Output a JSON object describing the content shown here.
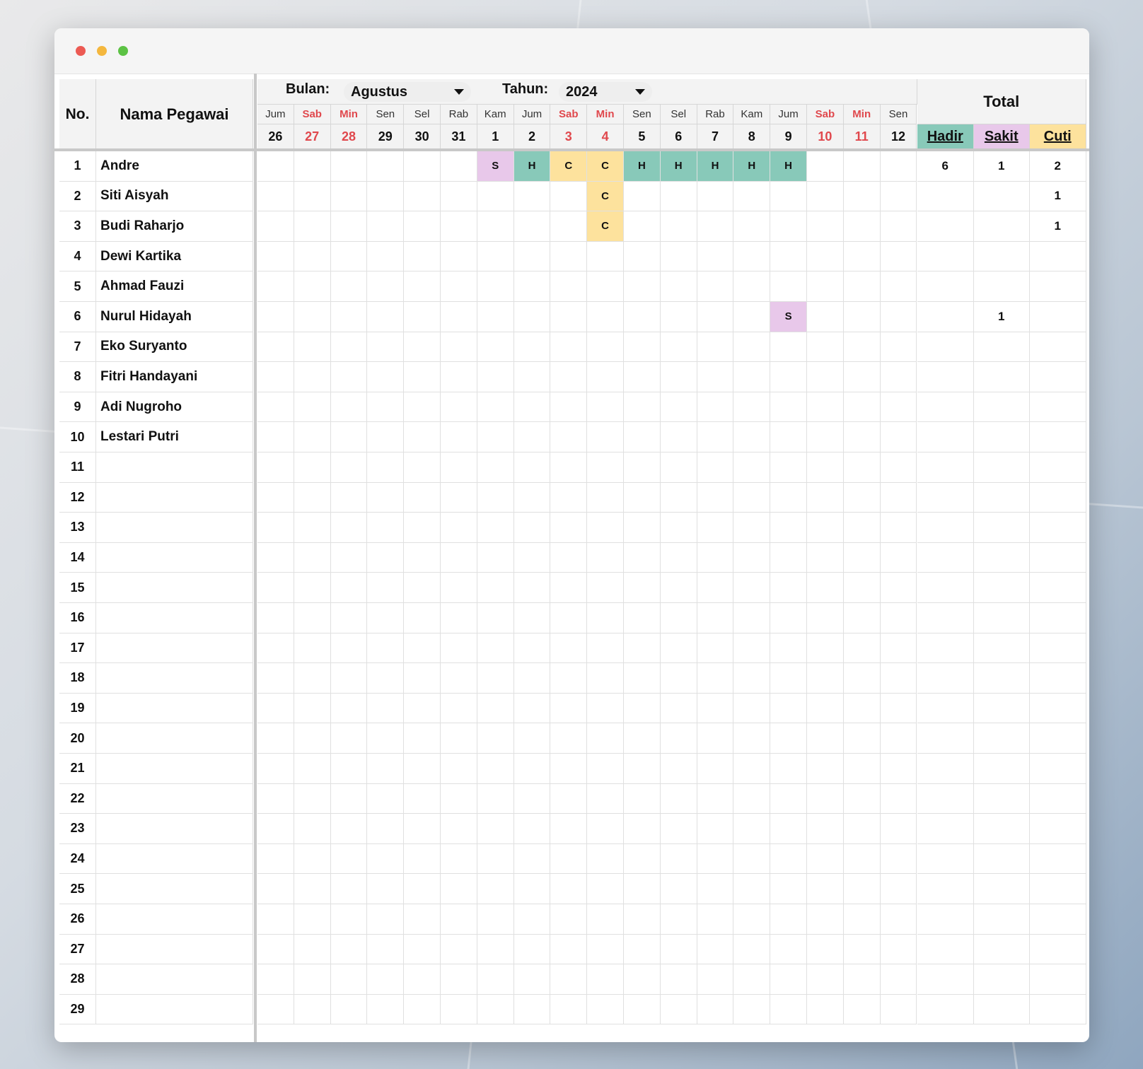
{
  "window": {
    "controls": [
      "close",
      "minimize",
      "maximize"
    ]
  },
  "header": {
    "no_label": "No.",
    "name_label": "Nama Pegawai",
    "month_label": "Bulan:",
    "month_value": "Agustus",
    "year_label": "Tahun:",
    "year_value": "2024",
    "total_label": "Total",
    "hadir_label": "Hadir",
    "sakit_label": "Sakit",
    "cuti_label": "Cuti"
  },
  "days": [
    {
      "weekday": "Jum",
      "date": "26",
      "weekend": false
    },
    {
      "weekday": "Sab",
      "date": "27",
      "weekend": true
    },
    {
      "weekday": "Min",
      "date": "28",
      "weekend": true
    },
    {
      "weekday": "Sen",
      "date": "29",
      "weekend": false
    },
    {
      "weekday": "Sel",
      "date": "30",
      "weekend": false
    },
    {
      "weekday": "Rab",
      "date": "31",
      "weekend": false
    },
    {
      "weekday": "Kam",
      "date": "1",
      "weekend": false
    },
    {
      "weekday": "Jum",
      "date": "2",
      "weekend": false
    },
    {
      "weekday": "Sab",
      "date": "3",
      "weekend": true
    },
    {
      "weekday": "Min",
      "date": "4",
      "weekend": true
    },
    {
      "weekday": "Sen",
      "date": "5",
      "weekend": false
    },
    {
      "weekday": "Sel",
      "date": "6",
      "weekend": false
    },
    {
      "weekday": "Rab",
      "date": "7",
      "weekend": false
    },
    {
      "weekday": "Kam",
      "date": "8",
      "weekend": false
    },
    {
      "weekday": "Jum",
      "date": "9",
      "weekend": false
    },
    {
      "weekday": "Sab",
      "date": "10",
      "weekend": true
    },
    {
      "weekday": "Min",
      "date": "11",
      "weekend": true
    },
    {
      "weekday": "Sen",
      "date": "12",
      "weekend": false
    }
  ],
  "rows": [
    {
      "no": "1",
      "name": "Andre",
      "marks": [
        "",
        "",
        "",
        "",
        "",
        "",
        "S",
        "H",
        "C",
        "C",
        "H",
        "H",
        "H",
        "H",
        "H",
        "",
        "",
        ""
      ],
      "hadir": "6",
      "sakit": "1",
      "cuti": "2"
    },
    {
      "no": "2",
      "name": "Siti Aisyah",
      "marks": [
        "",
        "",
        "",
        "",
        "",
        "",
        "",
        "",
        "",
        "C",
        "",
        "",
        "",
        "",
        "",
        "",
        "",
        ""
      ],
      "hadir": "",
      "sakit": "",
      "cuti": "1"
    },
    {
      "no": "3",
      "name": "Budi Raharjo",
      "marks": [
        "",
        "",
        "",
        "",
        "",
        "",
        "",
        "",
        "",
        "C",
        "",
        "",
        "",
        "",
        "",
        "",
        "",
        ""
      ],
      "hadir": "",
      "sakit": "",
      "cuti": "1"
    },
    {
      "no": "4",
      "name": "Dewi Kartika",
      "marks": [],
      "hadir": "",
      "sakit": "",
      "cuti": ""
    },
    {
      "no": "5",
      "name": "Ahmad Fauzi",
      "marks": [],
      "hadir": "",
      "sakit": "",
      "cuti": ""
    },
    {
      "no": "6",
      "name": "Nurul Hidayah",
      "marks": [
        "",
        "",
        "",
        "",
        "",
        "",
        "",
        "",
        "",
        "",
        "",
        "",
        "",
        "",
        "S",
        "",
        "",
        ""
      ],
      "hadir": "",
      "sakit": "1",
      "cuti": ""
    },
    {
      "no": "7",
      "name": "Eko Suryanto",
      "marks": [],
      "hadir": "",
      "sakit": "",
      "cuti": ""
    },
    {
      "no": "8",
      "name": "Fitri Handayani",
      "marks": [],
      "hadir": "",
      "sakit": "",
      "cuti": ""
    },
    {
      "no": "9",
      "name": "Adi Nugroho",
      "marks": [],
      "hadir": "",
      "sakit": "",
      "cuti": ""
    },
    {
      "no": "10",
      "name": "Lestari Putri",
      "marks": [],
      "hadir": "",
      "sakit": "",
      "cuti": ""
    },
    {
      "no": "11",
      "name": "",
      "marks": [],
      "hadir": "",
      "sakit": "",
      "cuti": ""
    },
    {
      "no": "12",
      "name": "",
      "marks": [],
      "hadir": "",
      "sakit": "",
      "cuti": ""
    },
    {
      "no": "13",
      "name": "",
      "marks": [],
      "hadir": "",
      "sakit": "",
      "cuti": ""
    },
    {
      "no": "14",
      "name": "",
      "marks": [],
      "hadir": "",
      "sakit": "",
      "cuti": ""
    },
    {
      "no": "15",
      "name": "",
      "marks": [],
      "hadir": "",
      "sakit": "",
      "cuti": ""
    },
    {
      "no": "16",
      "name": "",
      "marks": [],
      "hadir": "",
      "sakit": "",
      "cuti": ""
    },
    {
      "no": "17",
      "name": "",
      "marks": [],
      "hadir": "",
      "sakit": "",
      "cuti": ""
    },
    {
      "no": "18",
      "name": "",
      "marks": [],
      "hadir": "",
      "sakit": "",
      "cuti": ""
    },
    {
      "no": "19",
      "name": "",
      "marks": [],
      "hadir": "",
      "sakit": "",
      "cuti": ""
    },
    {
      "no": "20",
      "name": "",
      "marks": [],
      "hadir": "",
      "sakit": "",
      "cuti": ""
    },
    {
      "no": "21",
      "name": "",
      "marks": [],
      "hadir": "",
      "sakit": "",
      "cuti": ""
    },
    {
      "no": "22",
      "name": "",
      "marks": [],
      "hadir": "",
      "sakit": "",
      "cuti": ""
    },
    {
      "no": "23",
      "name": "",
      "marks": [],
      "hadir": "",
      "sakit": "",
      "cuti": ""
    },
    {
      "no": "24",
      "name": "",
      "marks": [],
      "hadir": "",
      "sakit": "",
      "cuti": ""
    },
    {
      "no": "25",
      "name": "",
      "marks": [],
      "hadir": "",
      "sakit": "",
      "cuti": ""
    },
    {
      "no": "26",
      "name": "",
      "marks": [],
      "hadir": "",
      "sakit": "",
      "cuti": ""
    },
    {
      "no": "27",
      "name": "",
      "marks": [],
      "hadir": "",
      "sakit": "",
      "cuti": ""
    },
    {
      "no": "28",
      "name": "",
      "marks": [],
      "hadir": "",
      "sakit": "",
      "cuti": ""
    },
    {
      "no": "29",
      "name": "",
      "marks": [],
      "hadir": "",
      "sakit": "",
      "cuti": ""
    }
  ],
  "colors": {
    "hadir": "#88c9b9",
    "sakit": "#e8c8ea",
    "cuti": "#fde29d",
    "weekend_text": "#e0484d",
    "header_bg": "#f3f3f3"
  }
}
